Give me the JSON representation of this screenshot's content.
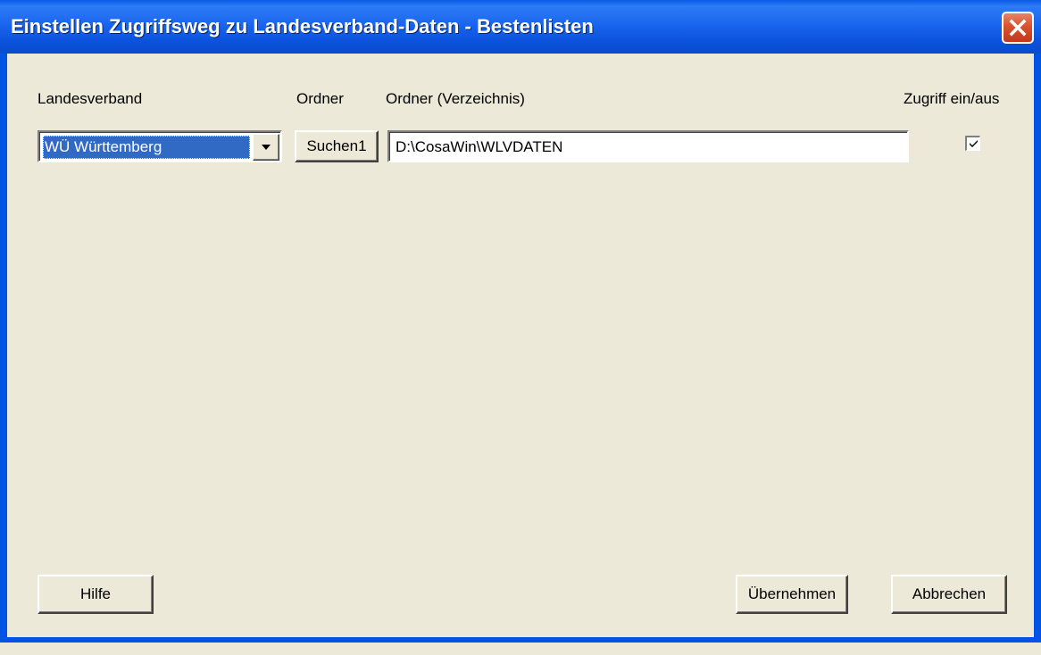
{
  "window": {
    "title": "Einstellen Zugriffsweg zu Landesverband-Daten  - Bestenlisten",
    "close_icon": "close-icon"
  },
  "columns": {
    "landesverband": "Landesverband",
    "ordner": "Ordner",
    "ordner_verzeichnis": "Ordner (Verzeichnis)",
    "zugriff": "Zugriff ein/aus"
  },
  "row": {
    "landesverband_selected": "WÜ Württemberg",
    "search_button": "Suchen1",
    "folder_path": "D:\\CosaWin\\WLVDATEN",
    "access_enabled": true
  },
  "buttons": {
    "help": "Hilfe",
    "apply": "Übernehmen",
    "cancel": "Abbrechen"
  },
  "colors": {
    "titlebar": "#0A5BE6",
    "face": "#ECE9D8",
    "selection": "#316AC5",
    "close": "#D9532F"
  }
}
